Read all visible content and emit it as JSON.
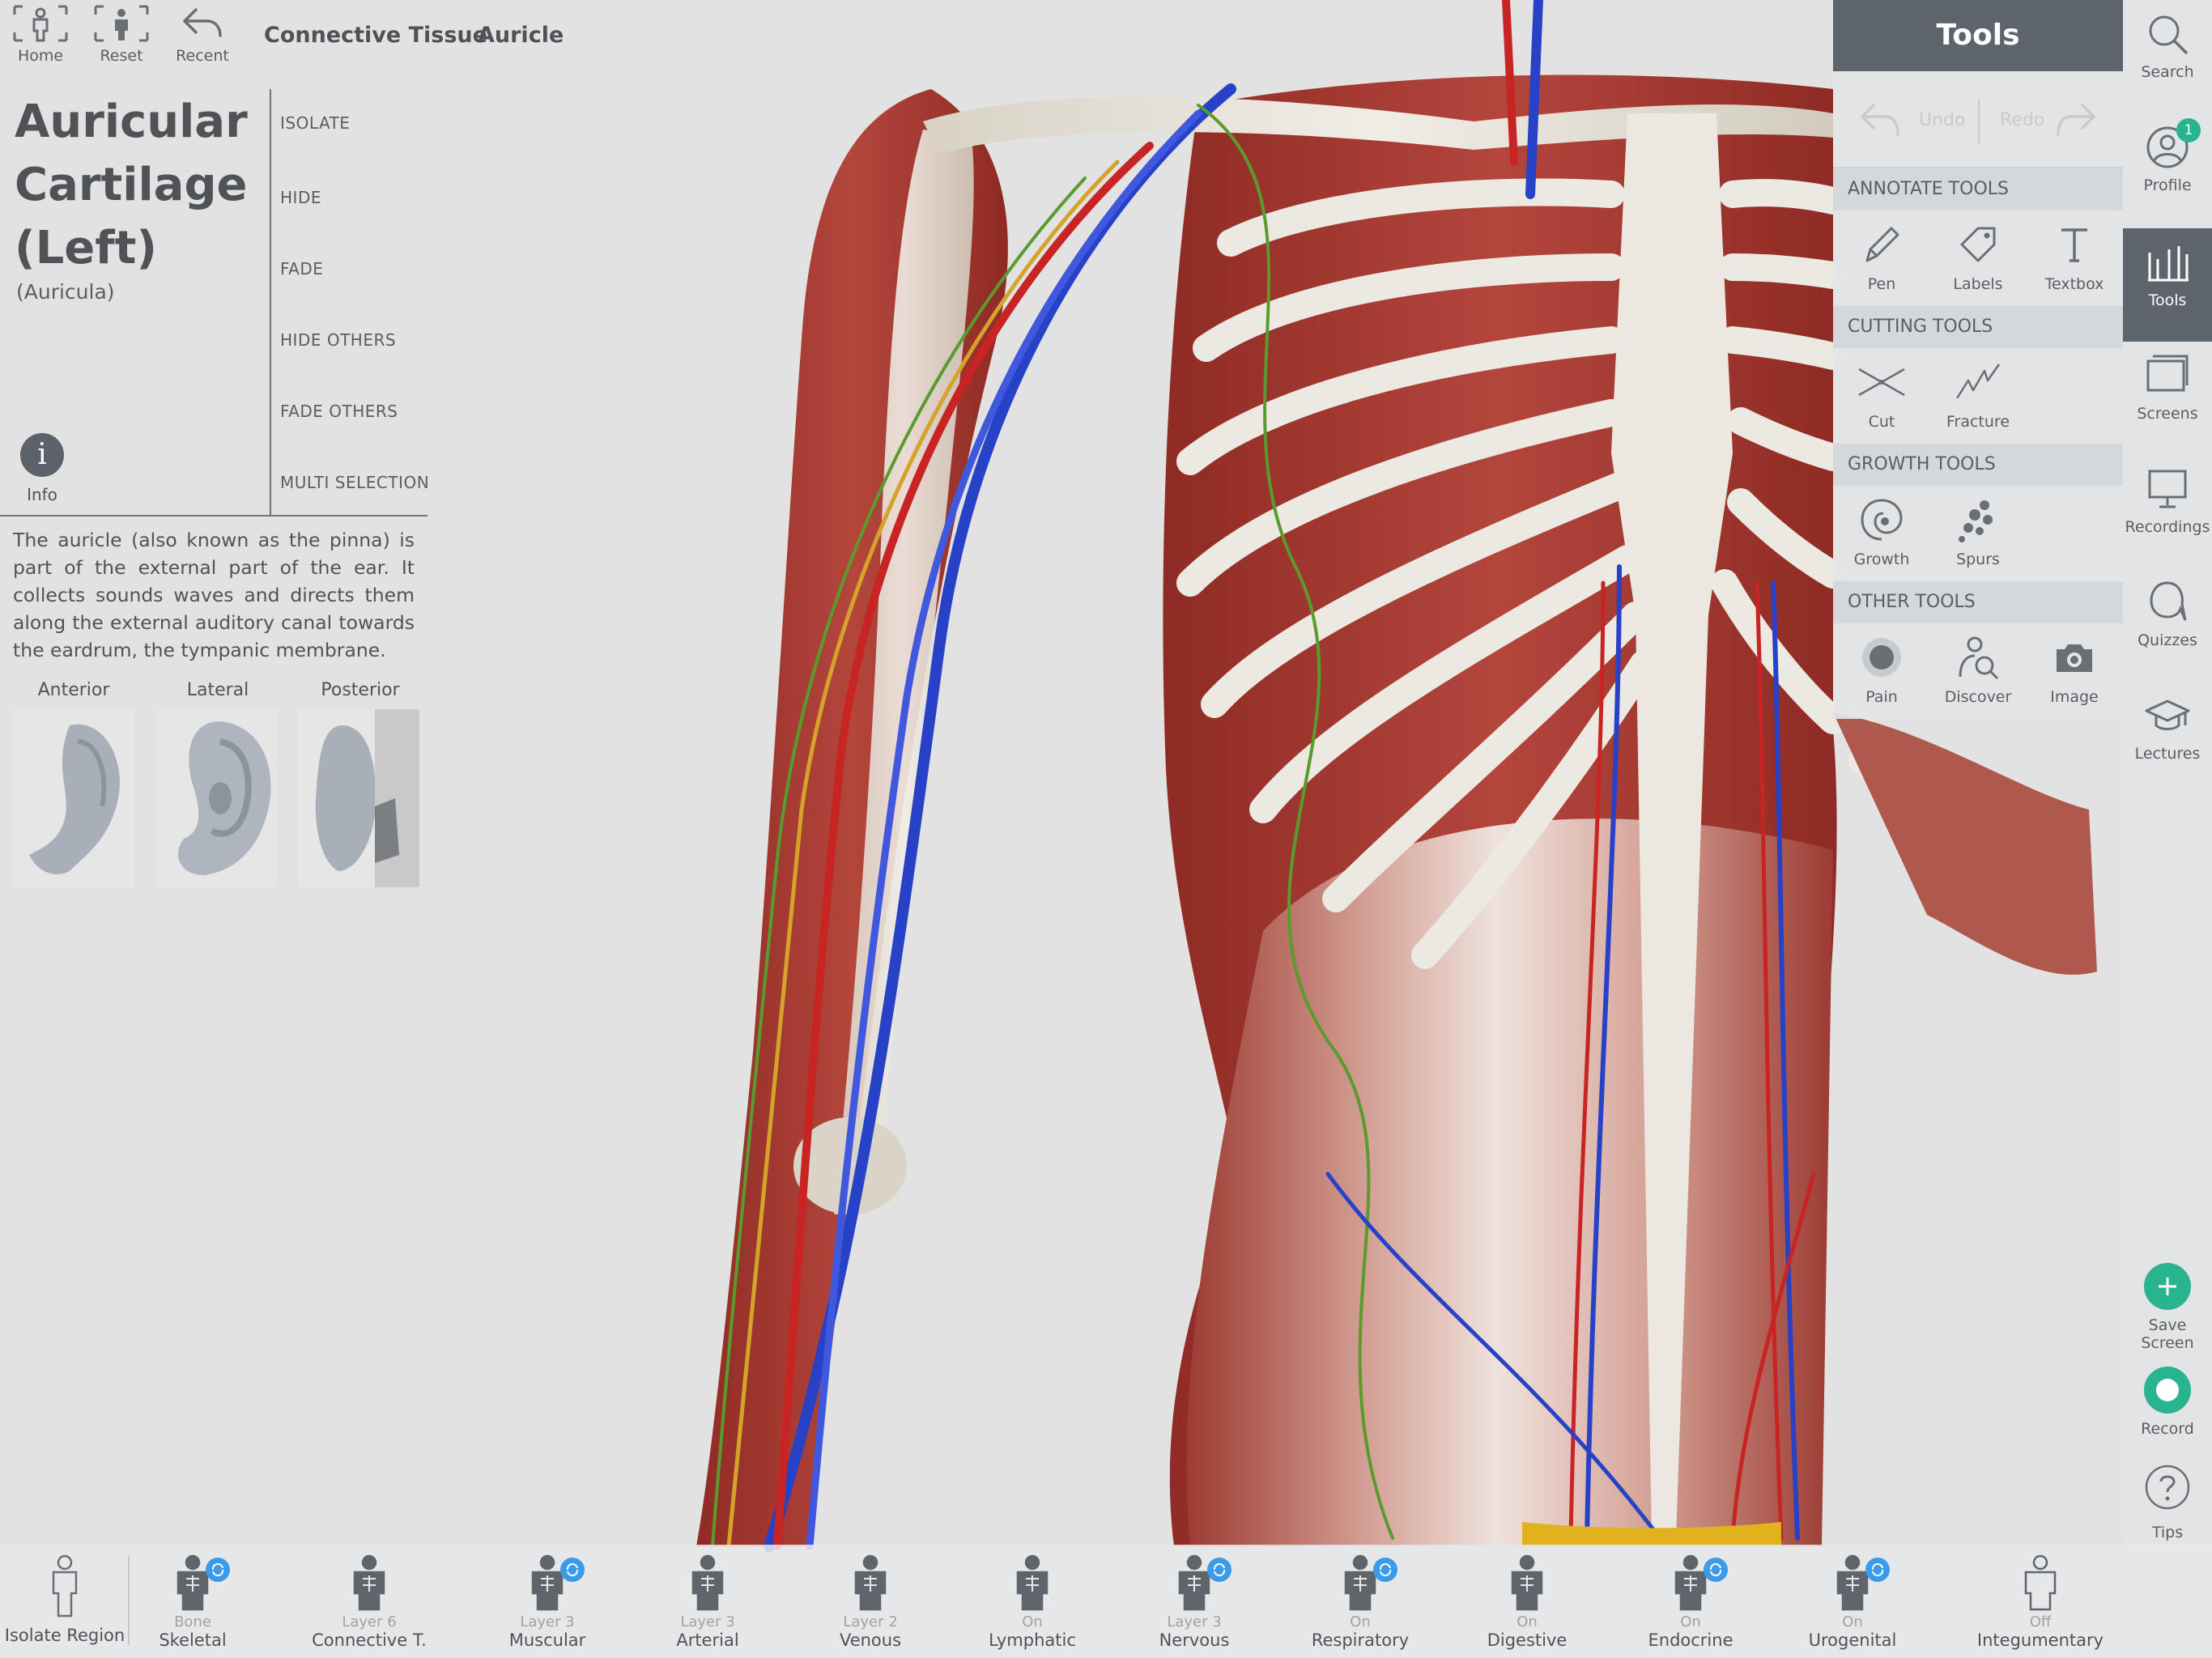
{
  "topbar": {
    "home_label": "Home",
    "reset_label": "Reset",
    "recent_label": "Recent",
    "breadcrumbs": [
      "Connective Tissue",
      "Auricle"
    ]
  },
  "structure": {
    "title_lines": [
      "Auricular",
      "Cartilage",
      "(Left)"
    ],
    "latin_name": "(Auricula)",
    "info_label": "Info",
    "description": "The auricle (also known as the pinna) is part of the external part of the ear. It collects sounds waves and directs them along the external auditory canal towards the eardrum, the tympanic membrane.",
    "views": [
      "Anterior",
      "Lateral",
      "Posterior"
    ]
  },
  "actions": [
    "ISOLATE",
    "HIDE",
    "FADE",
    "HIDE OTHERS",
    "FADE OTHERS",
    "MULTI SELECTION"
  ],
  "tools": {
    "title": "Tools",
    "undo_label": "Undo",
    "redo_label": "Redo",
    "annotate_header": "ANNOTATE TOOLS",
    "annotate": [
      "Pen",
      "Labels",
      "Textbox"
    ],
    "cutting_header": "CUTTING TOOLS",
    "cutting": [
      "Cut",
      "Fracture"
    ],
    "growth_header": "GROWTH TOOLS",
    "growth": [
      "Growth",
      "Spurs"
    ],
    "other_header": "OTHER TOOLS",
    "other": [
      "Pain",
      "Discover",
      "Image"
    ]
  },
  "sidebar": {
    "search": "Search",
    "profile": "Profile",
    "profile_badge": "1",
    "tools": "Tools",
    "screens": "Screens",
    "recordings": "Recordings",
    "quizzes": "Quizzes",
    "lectures": "Lectures",
    "save_screen_line1": "Save",
    "save_screen_line2": "Screen",
    "record": "Record",
    "tips": "Tips"
  },
  "systems": {
    "isolate_region": "Isolate Region",
    "items": [
      {
        "state": "Bone",
        "name": "Skeletal"
      },
      {
        "state": "Layer 6",
        "name": "Connective T."
      },
      {
        "state": "Layer 3",
        "name": "Muscular"
      },
      {
        "state": "Layer 3",
        "name": "Arterial"
      },
      {
        "state": "Layer 2",
        "name": "Venous"
      },
      {
        "state": "On",
        "name": "Lymphatic"
      },
      {
        "state": "Layer 3",
        "name": "Nervous"
      },
      {
        "state": "On",
        "name": "Respiratory"
      },
      {
        "state": "On",
        "name": "Digestive"
      },
      {
        "state": "On",
        "name": "Endocrine"
      },
      {
        "state": "On",
        "name": "Urogenital"
      },
      {
        "state": "Off",
        "name": "Integumentary"
      }
    ]
  },
  "colors": {
    "panel_dark": "#5e646b",
    "accent_green": "#28b48f",
    "sync_blue": "#3b9be8"
  }
}
